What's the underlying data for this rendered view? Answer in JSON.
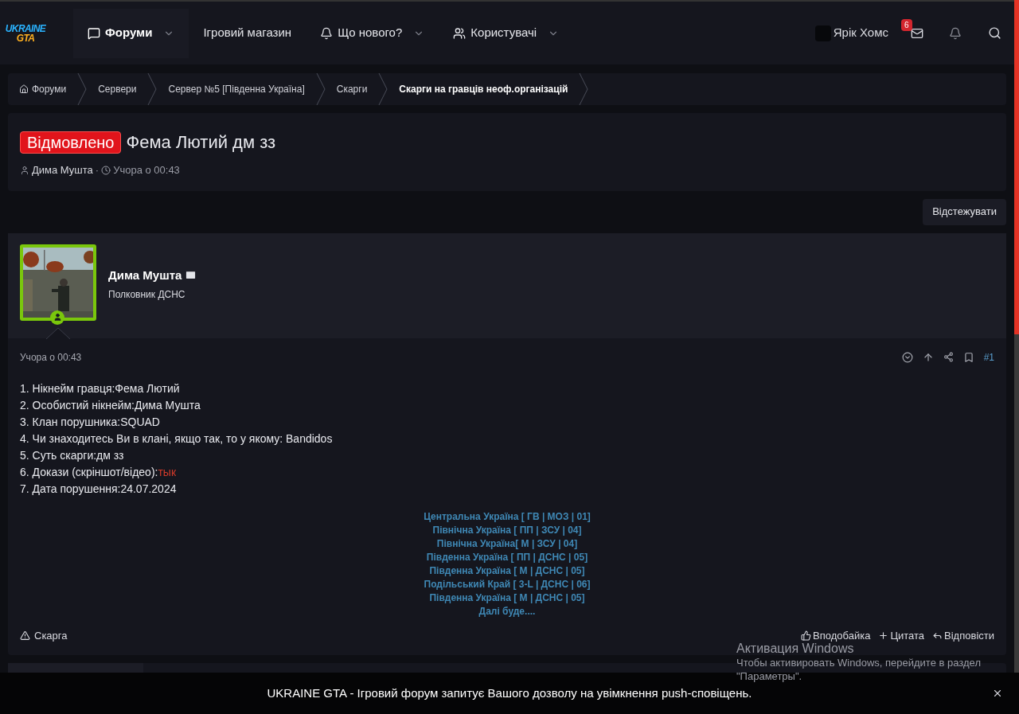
{
  "logo": {
    "top": "UKRAINE",
    "bottom": "GTA"
  },
  "nav": [
    {
      "label": "Форуми",
      "dropdown": true,
      "selected": true
    },
    {
      "label": "Ігровий магазин",
      "dropdown": false,
      "selected": false
    },
    {
      "label": "Що нового?",
      "dropdown": true,
      "selected": false
    },
    {
      "label": "Користувачі",
      "dropdown": true,
      "selected": false
    }
  ],
  "account": {
    "name": "Ярік Хомс",
    "inbox_count": "6"
  },
  "breadcrumbs": [
    {
      "label": "Форуми",
      "current": false
    },
    {
      "label": "Сервери",
      "current": false
    },
    {
      "label": "Сервер №5 [Південна Україна]",
      "current": false
    },
    {
      "label": "Скарги",
      "current": false
    },
    {
      "label": "Скарги на гравців неоф.організацій",
      "current": true
    }
  ],
  "thread": {
    "prefix": "Відмовлено",
    "title": "Фема Лютий дм зз",
    "author": "Дима Мушта",
    "separator": "·",
    "time": "Учора о 00:43"
  },
  "watch_button": "Відстежувати",
  "post": {
    "author": "Дима Мушта",
    "role": "Полковник ДСНС",
    "time": "Учора о 00:43",
    "number": "#1",
    "lines": [
      {
        "text": "1. Нікнейм гравця:Фема Лютий"
      },
      {
        "text": "2. Особистий нікнейм:Дима Мушта"
      },
      {
        "text": "3. Клан порушника:SQUAD"
      },
      {
        "text": "4. Чи знаходитесь Ви в клані, якщо так, то у якому: Bandidos"
      },
      {
        "text": "5. Суть скарги:дм зз"
      },
      {
        "text": "6. Докази (скріншот/відео):",
        "link": "тык"
      },
      {
        "text": "7. Дата порушення:24.07.2024"
      }
    ],
    "signature": [
      "Центральна Україна [ ГВ | МОЗ | 01]",
      "Північна Україна [ ПП | ЗСУ | 04]",
      "Північна Україна[ М | ЗСУ | 04]",
      "Південна Україна [ ПП | ДСНС | 05]",
      "Південна Україна [ М | ДСНС | 05]",
      "Подільський Край [ 3-L | ДСНС | 06]",
      "Південна Україна [ М | ДСНС | 05]",
      "Далі буде...."
    ],
    "report": "Скарга",
    "actions": [
      "Вподобайка",
      "Цитата",
      "Відповісти"
    ]
  },
  "windows_notice": {
    "title": "Активация Windows",
    "text": "Чтобы активировать Windows, перейдите в раздел \"Параметры\"."
  },
  "push_bar": "UKRAINE GTA - Ігровий форум запитує Вашого дозволу на увімкнення push-сповіщень."
}
